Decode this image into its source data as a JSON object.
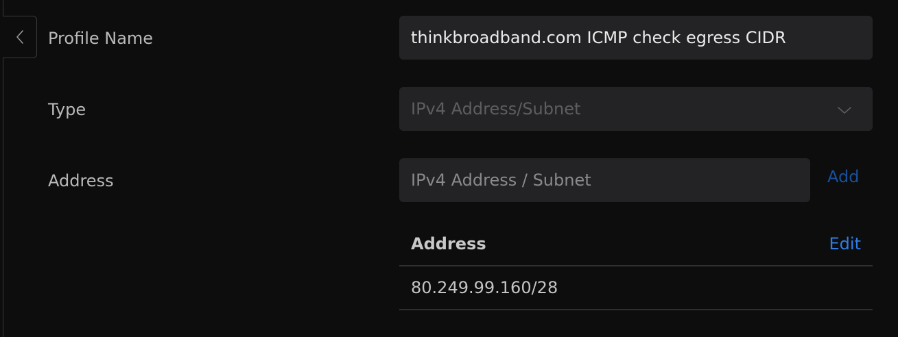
{
  "form": {
    "profile_name": {
      "label": "Profile Name",
      "value": "thinkbroadband.com ICMP check egress CIDR"
    },
    "type": {
      "label": "Type",
      "value": "IPv4 Address/Subnet",
      "icon": "chevron-down-icon"
    },
    "address": {
      "label": "Address",
      "placeholder": "IPv4 Address / Subnet",
      "add_label": "Add"
    }
  },
  "address_table": {
    "header": "Address",
    "edit_label": "Edit",
    "rows": [
      {
        "address": "80.249.99.160/28"
      }
    ]
  },
  "nav": {
    "back_icon": "chevron-left-icon"
  },
  "colors": {
    "background": "#0d0d0d",
    "field_background": "#232325",
    "link_primary": "#2f7de6",
    "link_dim": "#1a4f9c"
  }
}
